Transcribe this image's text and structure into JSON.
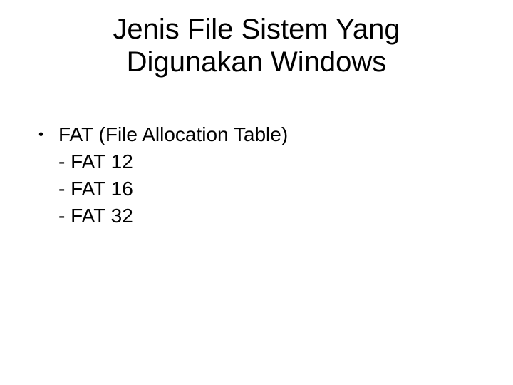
{
  "title_line1": "Jenis File Sistem Yang",
  "title_line2": "Digunakan Windows",
  "bullet_main": "FAT (File Allocation Table)",
  "sub1": "- FAT 12",
  "sub2": "- FAT 16",
  "sub3": "- FAT 32"
}
